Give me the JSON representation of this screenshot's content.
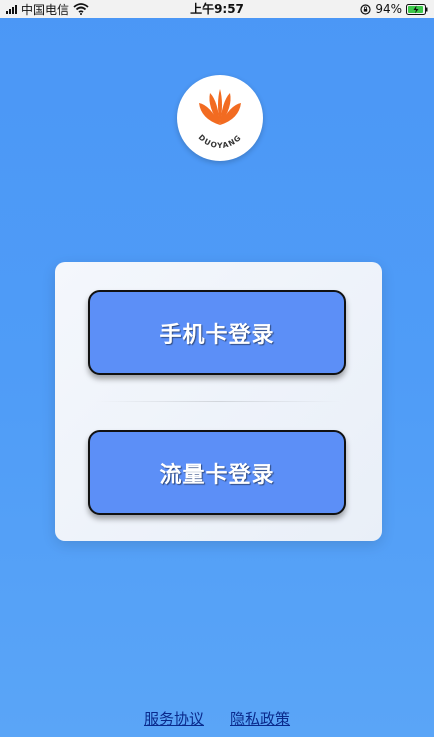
{
  "status_bar": {
    "carrier": "中国电信",
    "time": "上午9:57",
    "battery_percent": "94%",
    "battery_level": 0.94,
    "icons": [
      "signal-icon",
      "wifi-icon",
      "rotation-lock-icon",
      "battery-charging-icon"
    ]
  },
  "logo": {
    "text": "DUOYANG",
    "accent_color": "#f26b21"
  },
  "login": {
    "phone_card_label": "手机卡登录",
    "data_card_label": "流量卡登录"
  },
  "footer": {
    "service_agreement": "服务协议",
    "privacy_policy": "隐私政策"
  },
  "colors": {
    "background": "#4f9cf7",
    "button": "#5c8ff7",
    "link": "#0a2a8c"
  }
}
